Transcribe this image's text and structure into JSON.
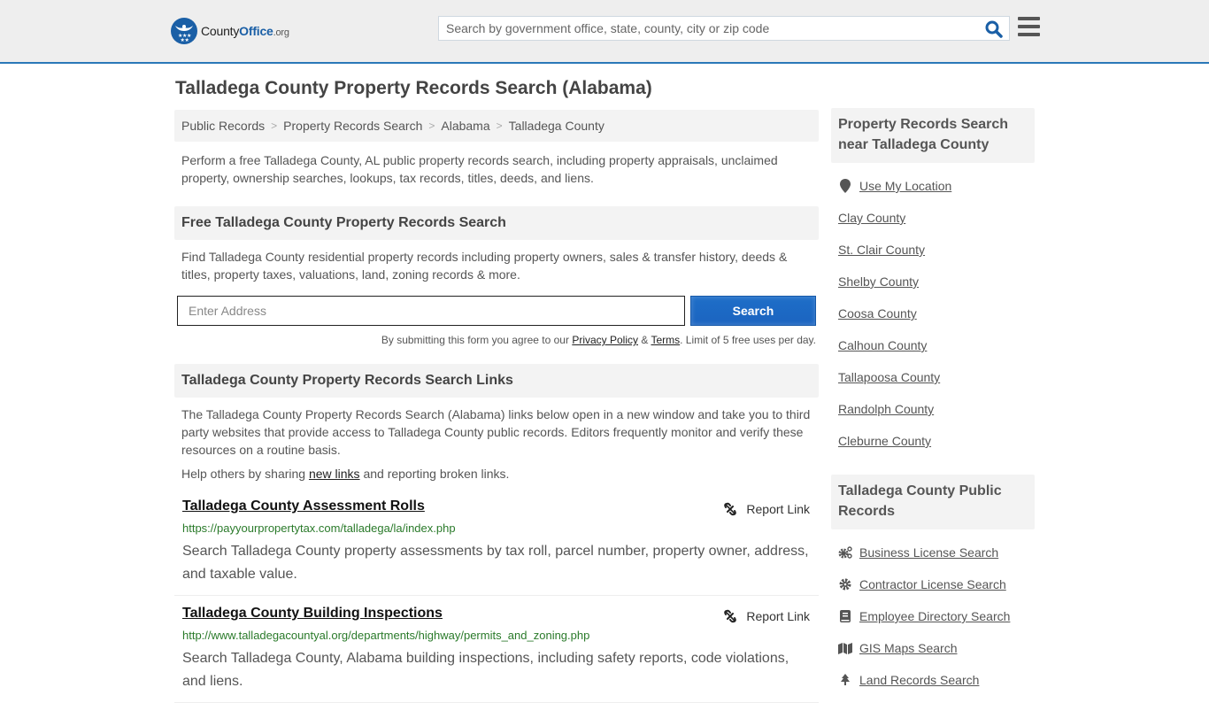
{
  "header": {
    "logo": {
      "county": "County",
      "office": "Office",
      "org": ".org"
    },
    "search_placeholder": "Search by government office, state, county, city or zip code",
    "accent_color": "#2a78b8"
  },
  "page_title": "Talladega County Property Records Search (Alabama)",
  "breadcrumb": [
    "Public Records",
    "Property Records Search",
    "Alabama",
    "Talladega County"
  ],
  "intro": "Perform a free Talladega County, AL public property records search, including property appraisals, unclaimed property, ownership searches, lookups, tax records, titles, deeds, and liens.",
  "free_search": {
    "heading": "Free Talladega County Property Records Search",
    "description": "Find Talladega County residential property records including property owners, sales & transfer history, deeds & titles, property taxes, valuations, land, zoning records & more.",
    "address_placeholder": "Enter Address",
    "button_label": "Search",
    "disclaimer_prefix": "By submitting this form you agree to our ",
    "privacy_label": "Privacy Policy",
    "amp": " & ",
    "terms_label": "Terms",
    "disclaimer_suffix": ". Limit of 5 free uses per day."
  },
  "links_section": {
    "heading": "Talladega County Property Records Search Links",
    "description": "The Talladega County Property Records Search (Alabama) links below open in a new window and take you to third party websites that provide access to Talladega County public records. Editors frequently monitor and verify these resources on a routine basis.",
    "help_prefix": "Help others by sharing ",
    "help_link": "new links",
    "help_suffix": " and reporting broken links.",
    "report_label": "Report Link",
    "items": [
      {
        "title": "Talladega County Assessment Rolls",
        "url": "https://payyourpropertytax.com/talladega/la/index.php",
        "description": "Search Talladega County property assessments by tax roll, parcel number, property owner, address, and taxable value."
      },
      {
        "title": "Talladega County Building Inspections",
        "url": "http://www.talladegacountyal.org/departments/highway/permits_and_zoning.php",
        "description": "Search Talladega County, Alabama building inspections, including safety reports, code violations, and liens."
      }
    ]
  },
  "sidebar": {
    "nearby": {
      "heading": "Property Records Search near Talladega County",
      "use_location": "Use My Location",
      "counties": [
        "Clay County",
        "St. Clair County",
        "Shelby County",
        "Coosa County",
        "Calhoun County",
        "Tallapoosa County",
        "Randolph County",
        "Cleburne County"
      ]
    },
    "public_records": {
      "heading": "Talladega County Public Records",
      "items": [
        {
          "label": "Business License Search",
          "icon": "cogs-icon"
        },
        {
          "label": "Contractor License Search",
          "icon": "gear-icon"
        },
        {
          "label": "Employee Directory Search",
          "icon": "book-icon"
        },
        {
          "label": "GIS Maps Search",
          "icon": "map-icon"
        },
        {
          "label": "Land Records Search",
          "icon": "tree-icon"
        }
      ]
    }
  }
}
